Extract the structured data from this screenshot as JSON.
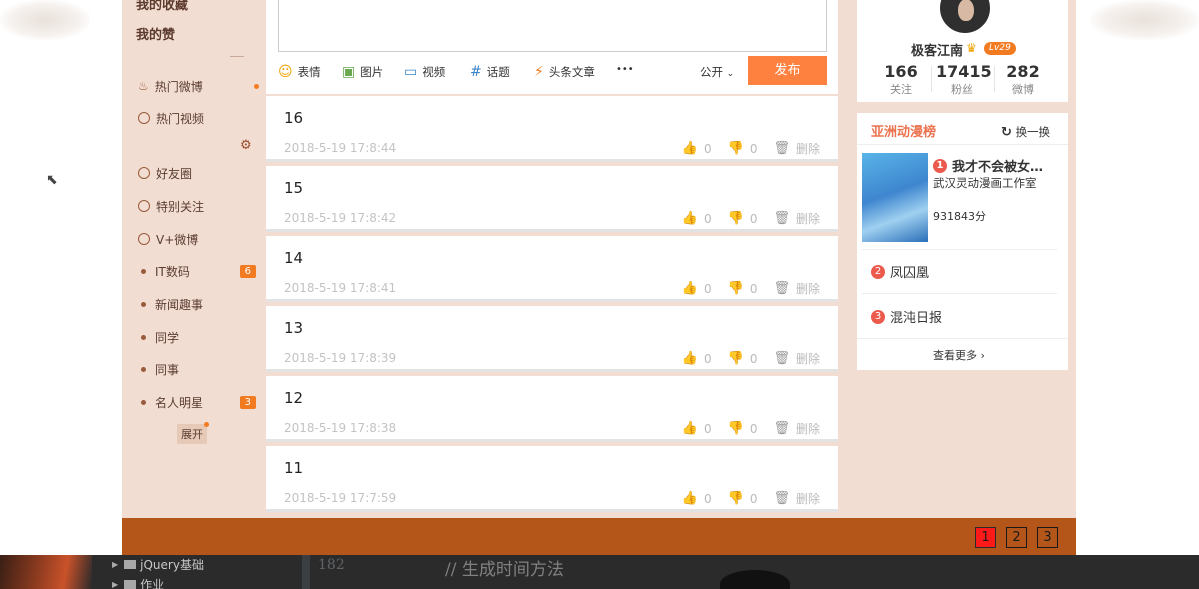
{
  "left_nav": {
    "top_items": [
      "我的收藏",
      "我的赞"
    ],
    "items": [
      {
        "label": "热门微博",
        "icon": "fire-icon",
        "badge": "",
        "new": true
      },
      {
        "label": "热门视频",
        "icon": "play-icon",
        "badge": "",
        "new": false
      },
      {
        "label": "好友圈",
        "icon": "circle-icon",
        "badge": "",
        "new": false
      },
      {
        "label": "特别关注",
        "icon": "eye-icon",
        "badge": "",
        "new": false
      },
      {
        "label": "V+微博",
        "icon": "vplus-icon",
        "badge": "",
        "new": false
      },
      {
        "label": "IT数码",
        "icon": "dot",
        "badge": "6",
        "new": false
      },
      {
        "label": "新闻趣事",
        "icon": "dot",
        "badge": "",
        "new": false
      },
      {
        "label": "同学",
        "icon": "dot",
        "badge": "",
        "new": false
      },
      {
        "label": "同事",
        "icon": "dot",
        "badge": "",
        "new": false
      },
      {
        "label": "名人明星",
        "icon": "dot",
        "badge": "3",
        "new": false
      }
    ],
    "expand_label": "展开"
  },
  "composer": {
    "tools": [
      "表情",
      "图片",
      "视频",
      "话题",
      "头条文章"
    ],
    "more": "•••",
    "privacy": "公开",
    "publish_label": "发布"
  },
  "feed": [
    {
      "num": "16",
      "time": "2018-5-19 17:8:44",
      "likes": "0",
      "dislikes": "0",
      "delete": "删除"
    },
    {
      "num": "15",
      "time": "2018-5-19 17:8:42",
      "likes": "0",
      "dislikes": "0",
      "delete": "删除"
    },
    {
      "num": "14",
      "time": "2018-5-19 17:8:41",
      "likes": "0",
      "dislikes": "0",
      "delete": "删除"
    },
    {
      "num": "13",
      "time": "2018-5-19 17:8:39",
      "likes": "0",
      "dislikes": "0",
      "delete": "删除"
    },
    {
      "num": "12",
      "time": "2018-5-19 17:8:38",
      "likes": "0",
      "dislikes": "0",
      "delete": "删除"
    },
    {
      "num": "11",
      "time": "2018-5-19 17:7:59",
      "likes": "0",
      "dislikes": "0",
      "delete": "删除"
    }
  ],
  "profile": {
    "name": "极客江南",
    "level": "Lv29",
    "stats": [
      {
        "value": "166",
        "label": "关注"
      },
      {
        "value": "17415",
        "label": "粉丝"
      },
      {
        "value": "282",
        "label": "微博"
      }
    ]
  },
  "ranking": {
    "title": "亚洲动漫榜",
    "refresh": "换一换",
    "items": [
      {
        "rank": "1",
        "title": "我才不会被女…",
        "author": "武汉灵动漫画工作室",
        "score": "931843分"
      },
      {
        "rank": "2",
        "title": "凤囚凰"
      },
      {
        "rank": "3",
        "title": "混沌日报"
      }
    ],
    "more": "查看更多"
  },
  "pagination": [
    "1",
    "2",
    "3"
  ],
  "ide": {
    "tree": [
      "jQuery基础",
      "作业"
    ],
    "line_number": "182",
    "code": "// 生成时间方法"
  }
}
